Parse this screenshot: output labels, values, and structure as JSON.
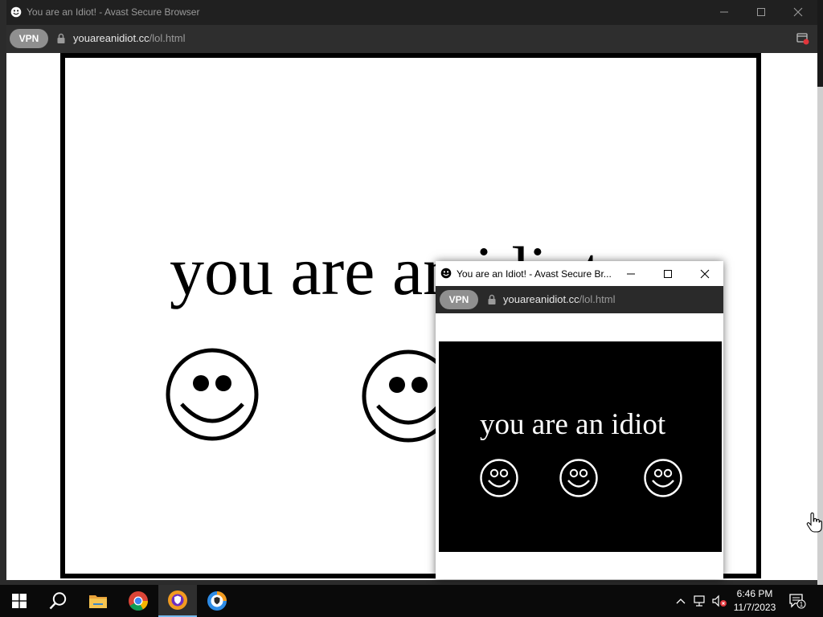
{
  "main_window": {
    "title": "You are an Idiot! - Avast Secure Browser",
    "vpn_label": "VPN",
    "url_domain": "youareanidiot.cc",
    "url_path": "/lol.html"
  },
  "page": {
    "headline": "you are an idiot",
    "smiley_count": 3
  },
  "popup_window": {
    "title": "You are an Idiot! - Avast Secure Br...",
    "vpn_label": "VPN",
    "url_domain": "youareanidiot.cc",
    "url_path": "/lol.html",
    "headline": "you are an idiot"
  },
  "taskbar": {
    "items": [
      "start-icon",
      "search-icon",
      "file-explorer-icon",
      "chrome-icon",
      "avast-secure-browser-icon",
      "avast-secure-browser-icon-2"
    ],
    "active_item": "avast-secure-browser-icon",
    "clock_time": "6:46 PM",
    "clock_date": "11/7/2023",
    "notification_count": "1"
  },
  "colors": {
    "titlebar": "#202020",
    "addressbar": "#2e2e2e",
    "taskbar": "#0a0a0a",
    "accent": "#76b9ed"
  }
}
